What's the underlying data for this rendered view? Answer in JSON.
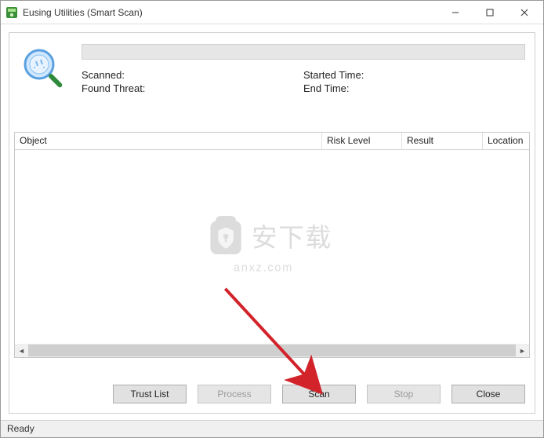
{
  "window": {
    "title": "Eusing Utilities (Smart Scan)"
  },
  "header": {
    "scanned_label": "Scanned:",
    "scanned_value": "",
    "found_threat_label": "Found Threat:",
    "found_threat_value": "",
    "started_time_label": "Started Time:",
    "started_time_value": "",
    "end_time_label": "End Time:",
    "end_time_value": ""
  },
  "table": {
    "columns": {
      "object": "Object",
      "risk": "Risk Level",
      "result": "Result",
      "location": "Location"
    }
  },
  "buttons": {
    "trust_list": "Trust List",
    "process": "Process",
    "scan": "Scan",
    "stop": "Stop",
    "close": "Close"
  },
  "status": {
    "text": "Ready"
  },
  "watermark": {
    "line1": "安下载",
    "line2": "anxz.com"
  }
}
